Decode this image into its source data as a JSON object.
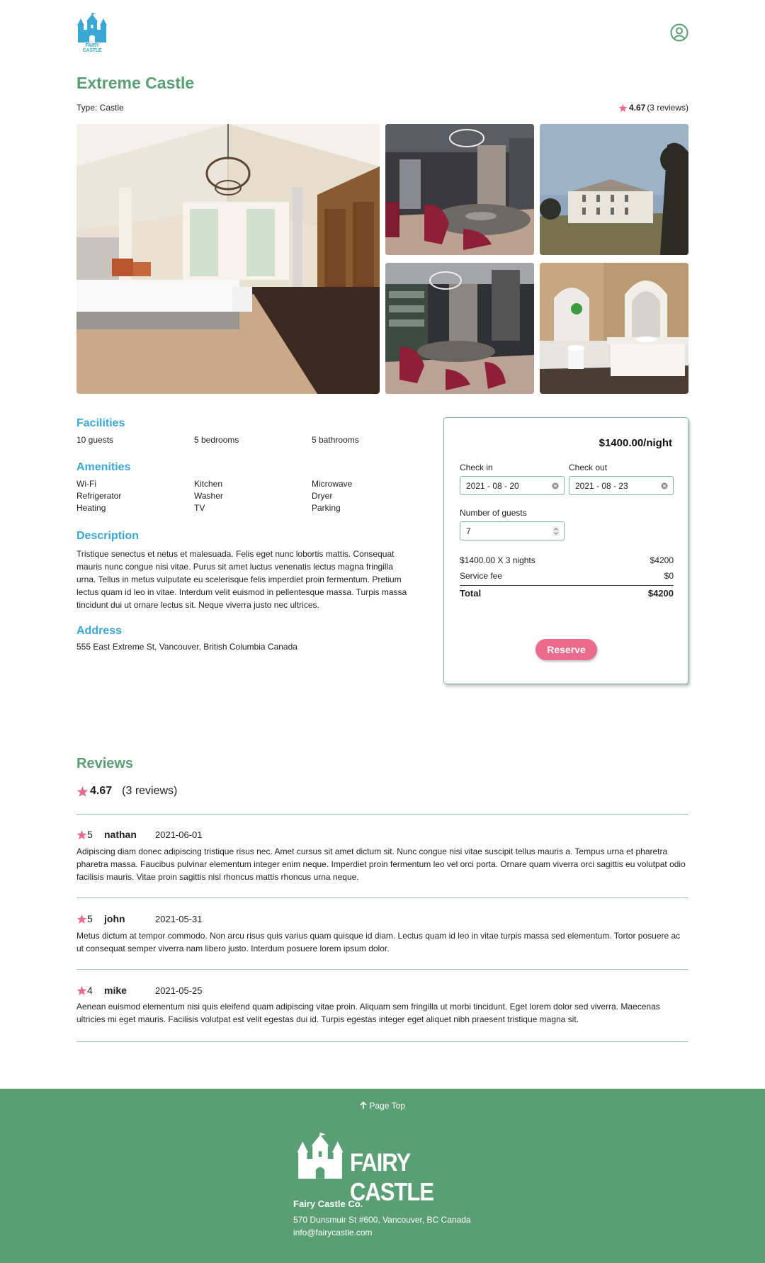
{
  "header": {
    "logo_text": "FAIRY CASTLE",
    "user_icon": "user-circle-icon"
  },
  "listing": {
    "title": "Extreme Castle",
    "type": "Type: Castle",
    "rating": "4.67",
    "reviews_count": "(3 reviews)"
  },
  "gallery": {
    "images": [
      "bedroom",
      "dining-room",
      "castle-exterior",
      "dining-room-2",
      "bathroom"
    ]
  },
  "facilities": {
    "title": "Facilities",
    "items": [
      "10 guests",
      "5 bedrooms",
      "5 bathrooms"
    ]
  },
  "amenities": {
    "title": "Amenities",
    "items": [
      "Wi-Fi",
      "Kitchen",
      "Microwave",
      "Refrigerator",
      "Washer",
      "Dryer",
      "Heating",
      "TV",
      "Parking"
    ]
  },
  "description": {
    "title": "Description",
    "text": "Tristique senectus et netus et malesuada. Felis eget nunc lobortis mattis. Consequat mauris nunc congue nisi vitae. Purus sit amet luctus venenatis lectus magna fringilla urna. Tellus in metus vulputate eu scelerisque felis imperdiet proin fermentum. Pretium lectus quam id leo in vitae. Interdum velit euismod in pellentesque massa. Turpis massa tincidunt dui ut ornare lectus sit. Neque viverra justo nec ultrices."
  },
  "address": {
    "title": "Address",
    "text": "555 East Extreme St, Vancouver, British Columbia Canada"
  },
  "booking": {
    "price_per_night": "$1400.00/night",
    "check_in_label": "Check in",
    "check_in_value": "2021 - 08 - 20",
    "check_out_label": "Check out",
    "check_out_value": "2021 - 08 - 23",
    "guests_label": "Number of guests",
    "guests_value": "7",
    "line_label": "$1400.00 X 3 nights",
    "line_value": "$4200",
    "fee_label": "Service fee",
    "fee_value": "$0",
    "total_label": "Total",
    "total_value": "$4200",
    "reserve_label": "Reserve"
  },
  "reviews": {
    "title": "Reviews",
    "rating": "4.67",
    "count": "(3 reviews)",
    "items": [
      {
        "score": "5",
        "name": "nathan",
        "date": "2021-06-01",
        "text": "Adipiscing diam donec adipiscing tristique risus nec. Amet cursus sit amet dictum sit. Nunc congue nisi vitae suscipit tellus mauris a. Tempus urna et pharetra pharetra massa. Faucibus pulvinar elementum integer enim neque. Imperdiet proin fermentum leo vel orci porta. Ornare quam viverra orci sagittis eu volutpat odio facilisis mauris. Vitae proin sagittis nisl rhoncus mattis rhoncus urna neque."
      },
      {
        "score": "5",
        "name": "john",
        "date": "2021-05-31",
        "text": "Metus dictum at tempor commodo. Non arcu risus quis varius quam quisque id diam. Lectus quam id leo in vitae turpis massa sed elementum. Tortor posuere ac ut consequat semper viverra nam libero justo. Interdum posuere lorem ipsum dolor."
      },
      {
        "score": "4",
        "name": "mike",
        "date": "2021-05-25",
        "text": "Aenean euismod elementum nisi quis eleifend quam adipiscing vitae proin. Aliquam sem fringilla ut morbi tincidunt. Eget lorem dolor sed viverra. Maecenas ultricies mi eget mauris. Facilisis volutpat est velit egestas dui id. Turpis egestas integer eget aliquet nibh praesent tristique magna sit."
      }
    ]
  },
  "footer": {
    "page_top": "Page Top",
    "logo_text": "FAIRY CASTLE",
    "company": "Fairy Castle Co.",
    "address": "570 Dunsmuir St #600, Vancouver, BC Canada",
    "email": "info@fairycastle.com"
  },
  "colors": {
    "brand_green": "#5a9e74",
    "accent_blue": "#3aa8d6",
    "accent_pink": "#ec6a8c"
  }
}
